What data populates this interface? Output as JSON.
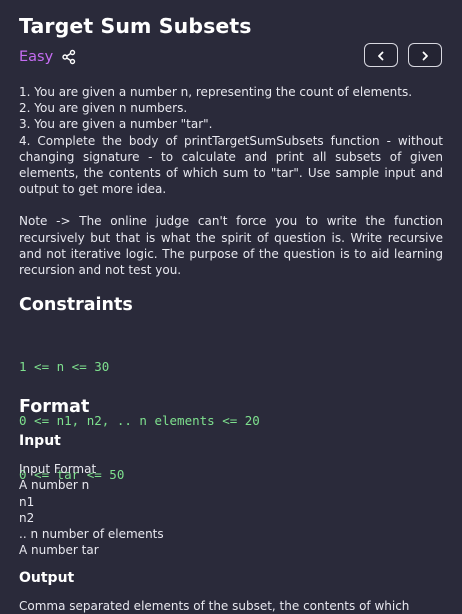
{
  "problem": {
    "title": "Target Sum Subsets",
    "difficulty": "Easy",
    "description": [
      "1. You are given a number n, representing the count of elements.",
      "2. You are given n numbers.",
      "3. You are given a number \"tar\".",
      "4. Complete the body of printTargetSumSubsets function - without changing signature - to calculate and print all subsets of given elements, the contents of which sum to \"tar\". Use sample input and output to get more idea."
    ],
    "note": "Note -> The online judge can't force you to write the function recursively but that is what the spirit of question is. Write recursive and not iterative logic. The purpose of the question is to aid learning recursion and not test you."
  },
  "constraints": {
    "heading": "Constraints",
    "lines": [
      "1 <= n <= 30",
      "0 <= n1, n2, .. n elements <= 20",
      "0 <= tar <= 50"
    ]
  },
  "format": {
    "heading": "Format",
    "input_heading": "Input",
    "input_lines": [
      "Input Format",
      "A number n",
      "n1",
      "n2",
      ".. n number of elements",
      "A number tar"
    ],
    "output_heading": "Output",
    "output_text": "Comma separated elements of the subset, the contents of which"
  },
  "icons": {
    "share": "share-icon",
    "prev": "chevron-left-icon",
    "next": "chevron-right-icon"
  },
  "colors": {
    "background": "#2a2a3a",
    "difficulty": "#c46cf2",
    "code": "#7ee08e"
  }
}
